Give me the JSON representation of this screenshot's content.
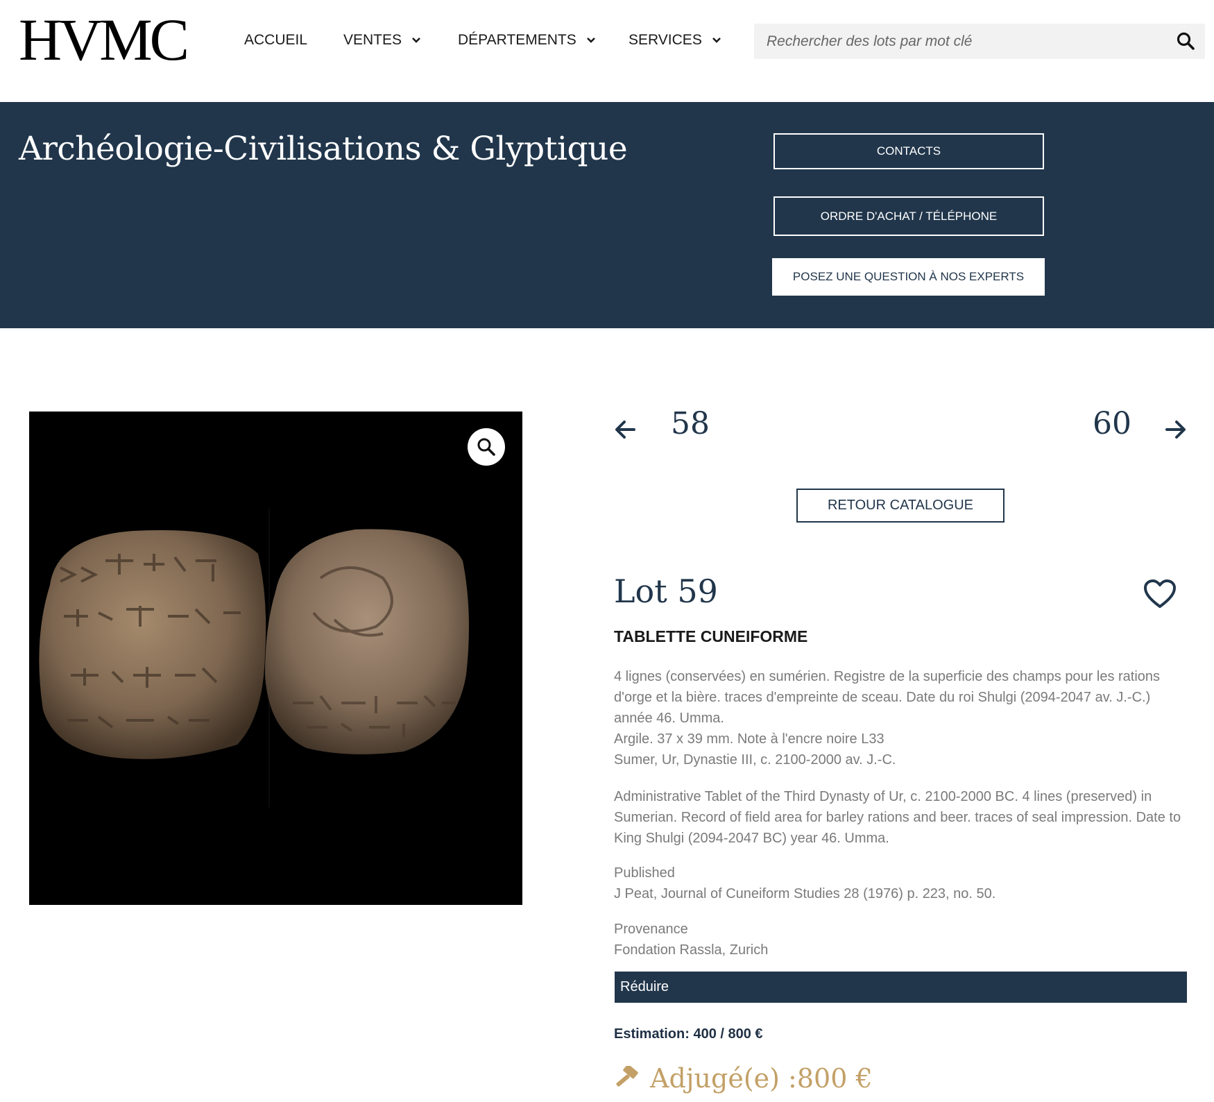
{
  "header": {
    "logo": "HVMC",
    "nav": [
      {
        "label": "ACCUEIL"
      },
      {
        "label": "VENTES"
      },
      {
        "label": "DÉPARTEMENTS"
      },
      {
        "label": "SERVICES"
      }
    ],
    "search": {
      "placeholder": "Rechercher des lots par mot clé"
    }
  },
  "banner": {
    "title": "Archéologie-Civilisations & Glyptique",
    "contacts_label": "CONTACTS",
    "ordre_label": "ORDRE D'ACHAT / TÉLÉPHONE",
    "question_label": "POSEZ UNE QUESTION À NOS EXPERTS"
  },
  "lot_nav": {
    "prev": "58",
    "next": "60",
    "back_label": "RETOUR CATALOGUE"
  },
  "lot": {
    "title": "Lot 59",
    "object_name": "TABLETTE CUNEIFORME",
    "description_fr": [
      "4 lignes (conservées) en sumérien. Registre de la superficie des champs pour les rations d'orge et la bière. traces d'empreinte de sceau. Date du roi Shulgi (2094-2047 av. J.-C.) année 46. Umma.",
      "Argile. 37 x 39 mm. Note à l'encre noire L33",
      "Sumer, Ur, Dynastie III, c. 2100-2000 av. J.-C."
    ],
    "description_en": "Administrative Tablet of the Third Dynasty of Ur, c. 2100-2000 BC. 4 lines (preserved) in Sumerian. Record of field area for barley rations and beer. traces of seal impression. Date to King Shulgi (2094-2047 BC) year 46. Umma.",
    "published_label": "Published",
    "published_value": "J Peat, Journal of Cuneiform Studies 28 (1976) p. 223, no. 50.",
    "provenance_label": "Provenance",
    "provenance_value": "Fondation Rassla, Zurich",
    "reduce_label": "Réduire",
    "estimation": "Estimation: 400 / 800 €",
    "sold": "Adjugé(e) :800 €"
  },
  "colors": {
    "navy": "#21364b",
    "gold": "#c3a067",
    "muted_text": "#7a7a7a"
  },
  "icons": [
    "search-icon",
    "chevron-down-icon",
    "zoom-icon",
    "arrow-left-icon",
    "arrow-right-icon",
    "heart-icon",
    "gavel-icon"
  ]
}
